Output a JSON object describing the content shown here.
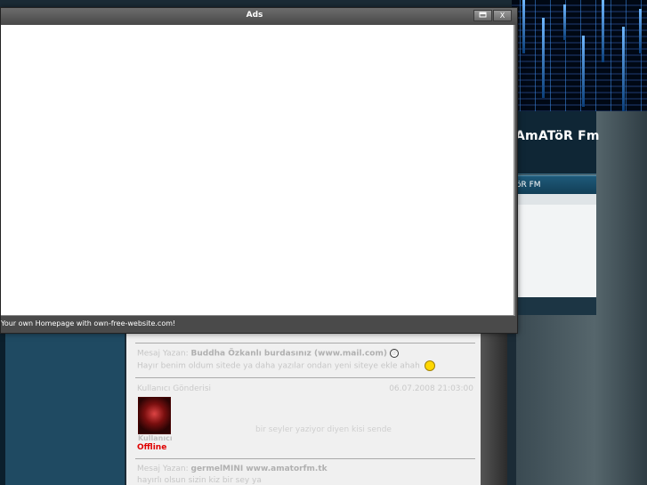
{
  "window": {
    "title": "Ads",
    "footer_text": "Your own Homepage with own-free-website.com!",
    "minimize_icon": "minimize-icon",
    "close_icon": "close-icon",
    "close_glyph": "X"
  },
  "site": {
    "title": "AmATöR Fm",
    "nav_label": "öR FM"
  },
  "forum": {
    "post1": {
      "line1_prefix": "Mesaj Yazan:",
      "line1_bold": "Buddha Özkanlı burdasınız (www.mail.com)",
      "line2": "Hayır benim oldum sitede ya daha yazılar ondan yeni siteye ekle ahah",
      "email_glyph": "@"
    },
    "post2": {
      "meta_left": "Kullanıcı Gönderisi",
      "meta_right": "06.07.2008 21:03:00",
      "username": "Kullanıcı",
      "status": "Offline",
      "signature": "bir seyler yaziyor diyen kisi sende"
    },
    "post3": {
      "line1_prefix": "Mesaj Yazan:",
      "line1_bold": "germelMINI www.amatorfm.tk",
      "line2": "hayırlı olsun sizin kiz bir sey ya"
    }
  }
}
